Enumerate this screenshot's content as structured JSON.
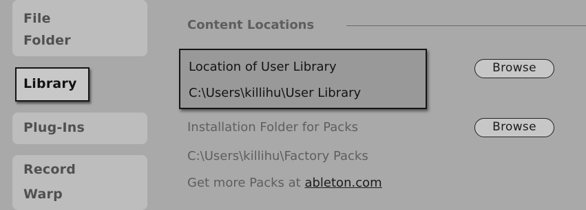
{
  "sidebar": {
    "items": [
      {
        "id": "file-folder",
        "lines": [
          "File",
          "Folder"
        ]
      },
      {
        "id": "library",
        "label": "Library",
        "selected": true
      },
      {
        "id": "plug-ins",
        "label": "Plug-Ins"
      },
      {
        "id": "record-warp",
        "lines": [
          "Record",
          "Warp"
        ]
      }
    ]
  },
  "content": {
    "section_title": "Content Locations",
    "user_library": {
      "label": "Location of User Library",
      "path": "C:\\Users\\killihu\\User Library",
      "browse_label": "Browse"
    },
    "packs": {
      "label": "Installation Folder for Packs",
      "path": "C:\\Users\\killihu\\Factory Packs",
      "browse_label": "Browse"
    },
    "get_more": {
      "prefix": "Get more Packs at ",
      "link_text": "ableton.com"
    }
  },
  "colors": {
    "background": "#a9a9a9",
    "sidebar_block": "#bdbdbd",
    "highlight_border": "#141414"
  }
}
